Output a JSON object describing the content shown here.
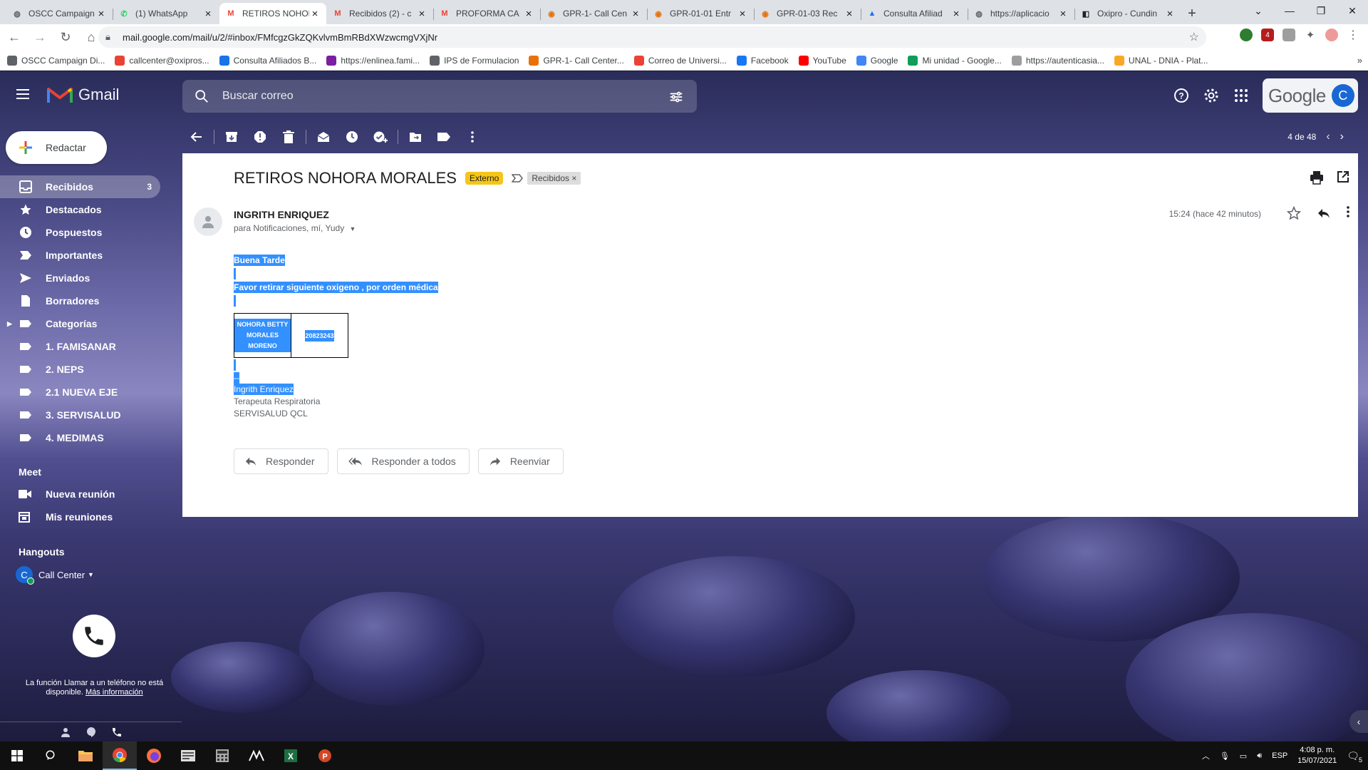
{
  "browser": {
    "tabs": [
      {
        "label": "OSCC Campaign",
        "icon": "globe-icon",
        "active": false
      },
      {
        "label": "(1) WhatsApp",
        "icon": "whatsapp-icon",
        "active": false
      },
      {
        "label": "RETIROS NOHORA",
        "icon": "gmail-icon",
        "active": true
      },
      {
        "label": "Recibidos (2) - c",
        "icon": "gmail-icon",
        "active": false
      },
      {
        "label": "PROFORMA CA",
        "icon": "gmail-icon",
        "active": false
      },
      {
        "label": "GPR-1- Call Cen",
        "icon": "app-icon",
        "active": false
      },
      {
        "label": "GPR-01-01 Entr",
        "icon": "app-icon",
        "active": false
      },
      {
        "label": "GPR-01-03 Rec",
        "icon": "app-icon",
        "active": false
      },
      {
        "label": "Consulta Afiliad",
        "icon": "drive-icon",
        "active": false
      },
      {
        "label": "https://aplicacio",
        "icon": "globe-icon",
        "active": false
      },
      {
        "label": "Oxipro - Cundin",
        "icon": "oxipro-icon",
        "active": false
      }
    ],
    "url": "mail.google.com/mail/u/2/#inbox/FMfcgzGkZQKvlvmBmRBdXWzwcmgVXjNr",
    "bookmarks": [
      {
        "label": "OSCC Campaign Di...",
        "color": "#5f6368"
      },
      {
        "label": "callcenter@oxipros...",
        "color": "#ea4335"
      },
      {
        "label": "Consulta Afiliados B...",
        "color": "#1a73e8"
      },
      {
        "label": "https://enlinea.fami...",
        "color": "#7b1fa2"
      },
      {
        "label": "IPS de Formulacion",
        "color": "#5f6368"
      },
      {
        "label": "GPR-1- Call Center...",
        "color": "#e8710a"
      },
      {
        "label": "Correo de Universi...",
        "color": "#ea4335"
      },
      {
        "label": "Facebook",
        "color": "#1877f2"
      },
      {
        "label": "YouTube",
        "color": "#ff0000"
      },
      {
        "label": "Google",
        "color": "#4285f4"
      },
      {
        "label": "Mi unidad - Google...",
        "color": "#0f9d58"
      },
      {
        "label": "https://autenticasia...",
        "color": "#9e9e9e"
      },
      {
        "label": "UNAL - DNIA - Plat...",
        "color": "#f9a825"
      }
    ]
  },
  "gmail": {
    "brand": "Gmail",
    "search_placeholder": "Buscar correo",
    "account_logo_text": "Google",
    "account_initial": "C",
    "compose_label": "Redactar",
    "labels": [
      {
        "label": "Recibidos",
        "count": "3",
        "icon": "inbox-icon",
        "active": true
      },
      {
        "label": "Destacados",
        "count": "",
        "icon": "star-icon"
      },
      {
        "label": "Pospuestos",
        "count": "",
        "icon": "clock-icon"
      },
      {
        "label": "Importantes",
        "count": "",
        "icon": "important-icon"
      },
      {
        "label": "Enviados",
        "count": "",
        "icon": "send-icon"
      },
      {
        "label": "Borradores",
        "count": "",
        "icon": "draft-icon"
      },
      {
        "label": "Categorías",
        "count": "",
        "icon": "label-icon"
      },
      {
        "label": "1. FAMISANAR",
        "count": "",
        "icon": "label-icon"
      },
      {
        "label": "2. NEPS",
        "count": "",
        "icon": "label-icon"
      },
      {
        "label": "2.1 NUEVA EJE",
        "count": "",
        "icon": "label-icon"
      },
      {
        "label": "3. SERVISALUD",
        "count": "",
        "icon": "label-icon"
      },
      {
        "label": "4. MEDIMAS",
        "count": "",
        "icon": "label-icon"
      }
    ],
    "meet": {
      "title": "Meet",
      "new_meeting": "Nueva reunión",
      "my_meetings": "Mis reuniones"
    },
    "hangouts": {
      "title": "Hangouts",
      "user_initial": "C",
      "user": "Call Center",
      "call_msg": "La función Llamar a un teléfono no está disponible.",
      "call_link": "Más información"
    },
    "pager": "4 de 48",
    "message": {
      "subject": "RETIROS NOHORA MORALES",
      "external_badge": "Externo",
      "label_chip": "Recibidos",
      "label_chip_x": "×",
      "sender": "INGRITH ENRIQUEZ",
      "recipients": "para Notificaciones, mí, Yudy",
      "time": "15:24 (hace 42 minutos)",
      "greeting": "Buena Tarde",
      "line1": "Favor retirar siguiente oxigeno , por orden médica",
      "table": [
        [
          "NOHORA BETTY MORALES MORENO",
          "20823243"
        ]
      ],
      "dash": "--",
      "signature_name": "Ingrith Enriquez",
      "signature_role": "Terapeuta Respiratoria",
      "signature_org": "SERVISALUD QCL"
    },
    "reply_buttons": {
      "reply": "Responder",
      "reply_all": "Responder a todos",
      "forward": "Reenviar"
    }
  },
  "taskbar": {
    "lang": "ESP",
    "time": "4:08 p. m.",
    "date": "15/07/2021",
    "notif_count": "5"
  }
}
